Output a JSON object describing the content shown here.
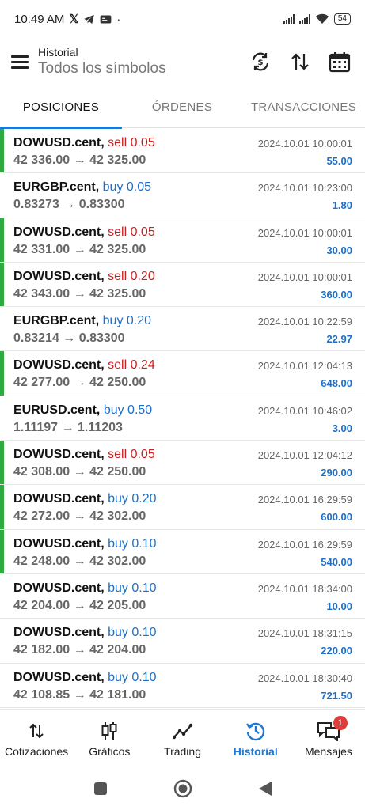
{
  "status_bar": {
    "time": "10:49 AM",
    "battery": "54"
  },
  "header": {
    "title": "Historial",
    "subtitle": "Todos los símbolos"
  },
  "tabs": [
    {
      "label": "POSICIONES",
      "active": true
    },
    {
      "label": "ÓRDENES",
      "active": false
    },
    {
      "label": "TRANSACCIONES",
      "active": false
    }
  ],
  "positions": [
    {
      "symbol": "DOWUSD.cent,",
      "type": "sell 0.05",
      "side": "sell",
      "prices": "42 336.00 → 42 325.00",
      "time": "2024.10.01 10:00:01",
      "profit": "55.00",
      "marked": true
    },
    {
      "symbol": "EURGBP.cent,",
      "type": "buy 0.05",
      "side": "buy",
      "prices": "0.83273 → 0.83300",
      "time": "2024.10.01 10:23:00",
      "profit": "1.80",
      "marked": false
    },
    {
      "symbol": "DOWUSD.cent,",
      "type": "sell 0.05",
      "side": "sell",
      "prices": "42 331.00 → 42 325.00",
      "time": "2024.10.01 10:00:01",
      "profit": "30.00",
      "marked": true
    },
    {
      "symbol": "DOWUSD.cent,",
      "type": "sell 0.20",
      "side": "sell",
      "prices": "42 343.00 → 42 325.00",
      "time": "2024.10.01 10:00:01",
      "profit": "360.00",
      "marked": true
    },
    {
      "symbol": "EURGBP.cent,",
      "type": "buy 0.20",
      "side": "buy",
      "prices": "0.83214 → 0.83300",
      "time": "2024.10.01 10:22:59",
      "profit": "22.97",
      "marked": false
    },
    {
      "symbol": "DOWUSD.cent,",
      "type": "sell 0.24",
      "side": "sell",
      "prices": "42 277.00 → 42 250.00",
      "time": "2024.10.01 12:04:13",
      "profit": "648.00",
      "marked": true
    },
    {
      "symbol": "EURUSD.cent,",
      "type": "buy 0.50",
      "side": "buy",
      "prices": "1.11197 → 1.11203",
      "time": "2024.10.01 10:46:02",
      "profit": "3.00",
      "marked": false
    },
    {
      "symbol": "DOWUSD.cent,",
      "type": "sell 0.05",
      "side": "sell",
      "prices": "42 308.00 → 42 250.00",
      "time": "2024.10.01 12:04:12",
      "profit": "290.00",
      "marked": true
    },
    {
      "symbol": "DOWUSD.cent,",
      "type": "buy 0.20",
      "side": "buy",
      "prices": "42 272.00 → 42 302.00",
      "time": "2024.10.01 16:29:59",
      "profit": "600.00",
      "marked": true
    },
    {
      "symbol": "DOWUSD.cent,",
      "type": "buy 0.10",
      "side": "buy",
      "prices": "42 248.00 → 42 302.00",
      "time": "2024.10.01 16:29:59",
      "profit": "540.00",
      "marked": true
    },
    {
      "symbol": "DOWUSD.cent,",
      "type": "buy 0.10",
      "side": "buy",
      "prices": "42 204.00 → 42 205.00",
      "time": "2024.10.01 18:34:00",
      "profit": "10.00",
      "marked": false
    },
    {
      "symbol": "DOWUSD.cent,",
      "type": "buy 0.10",
      "side": "buy",
      "prices": "42 182.00 → 42 204.00",
      "time": "2024.10.01 18:31:15",
      "profit": "220.00",
      "marked": false
    },
    {
      "symbol": "DOWUSD.cent,",
      "type": "buy 0.10",
      "side": "buy",
      "prices": "42 108.85 → 42 181.00",
      "time": "2024.10.01 18:30:40",
      "profit": "721.50",
      "marked": false
    }
  ],
  "bottom_nav": [
    {
      "label": "Cotizaciones",
      "icon": "quotes-arrows-icon",
      "active": false
    },
    {
      "label": "Gráficos",
      "icon": "candlestick-icon",
      "active": false
    },
    {
      "label": "Trading",
      "icon": "trading-line-icon",
      "active": false
    },
    {
      "label": "Historial",
      "icon": "history-clock-icon",
      "active": true
    },
    {
      "label": "Mensajes",
      "icon": "messages-icon",
      "active": false,
      "badge": "1"
    }
  ],
  "colors": {
    "accent": "#1e78d2",
    "sell": "#cc1f1f",
    "buy": "#1e6fc8",
    "profit_marker": "#2eaa3f",
    "badge": "#e23b3b"
  }
}
